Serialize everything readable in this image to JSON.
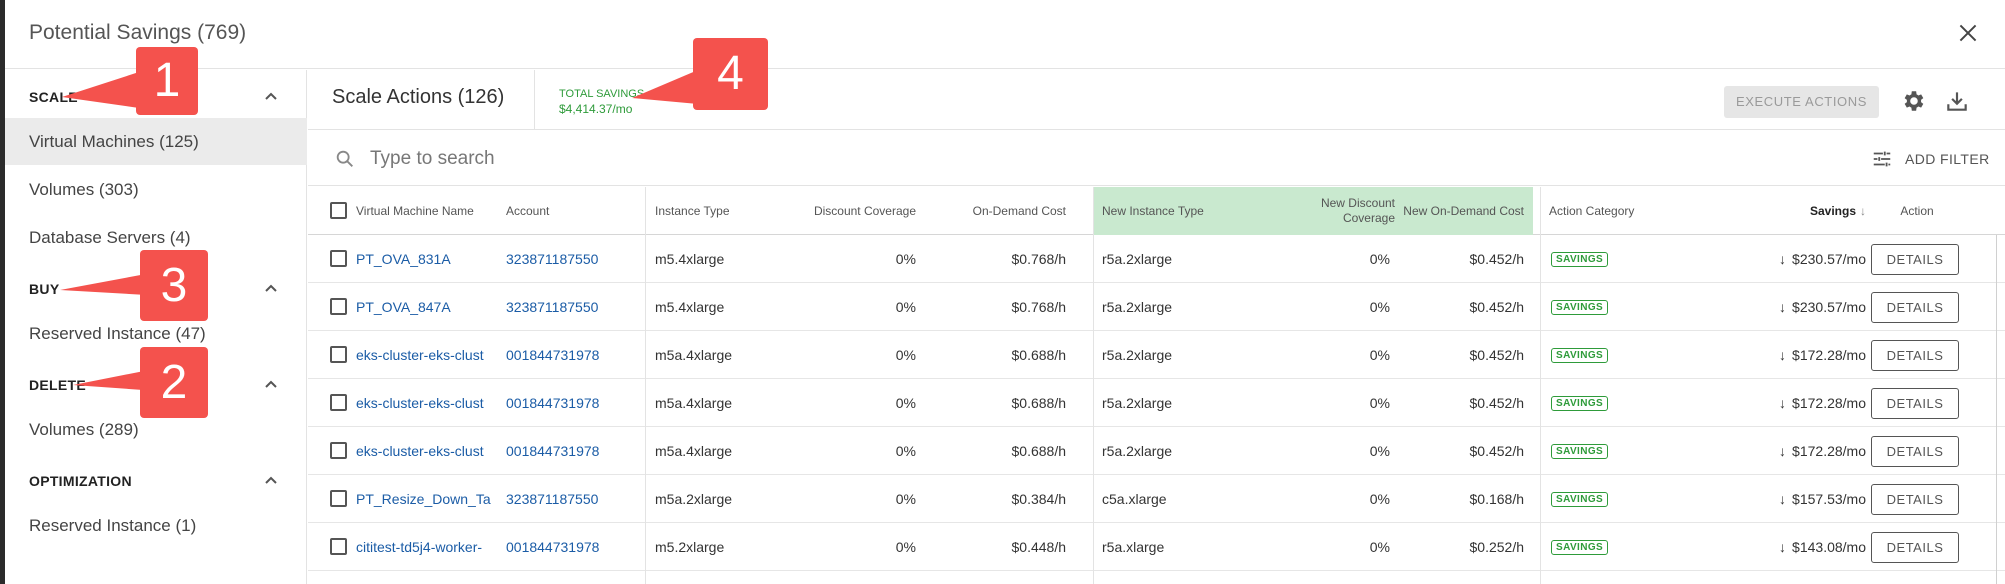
{
  "modal": {
    "title": "Potential Savings (769)"
  },
  "sidebar": {
    "sections": [
      {
        "label": "SCALE",
        "items": [
          "Virtual Machines (125)",
          "Volumes (303)",
          "Database Servers (4)"
        ]
      },
      {
        "label": "BUY",
        "items": [
          "Reserved Instance (47)"
        ]
      },
      {
        "label": "DELETE",
        "items": [
          "Volumes (289)"
        ]
      },
      {
        "label": "OPTIMIZATION",
        "items": [
          "Reserved Instance (1)"
        ]
      }
    ],
    "active_item": "Virtual Machines (125)"
  },
  "header": {
    "title": "Scale Actions (126)",
    "total_savings_label": "TOTAL SAVINGS",
    "total_savings_value": "$4,414.37/mo",
    "execute_label": "EXECUTE ACTIONS"
  },
  "search": {
    "placeholder": "Type to search",
    "add_filter_label": "ADD FILTER"
  },
  "table": {
    "columns": [
      "Virtual Machine Name",
      "Account",
      "Instance Type",
      "Discount Coverage",
      "On-Demand Cost",
      "New Instance Type",
      "New Discount Coverage",
      "New On-Demand Cost",
      "Action Category",
      "Savings",
      "Action"
    ],
    "highlight_color": "#c9e9cf",
    "rows": [
      {
        "name": "PT_OVA_831A",
        "account": "323871187550",
        "instance": "m5.4xlarge",
        "discount": "0%",
        "ondemand": "$0.768/h",
        "new_instance": "r5a.2xlarge",
        "new_discount": "0%",
        "new_ondemand": "$0.452/h",
        "category": "SAVINGS",
        "savings": "$230.57/mo",
        "action": "DETAILS"
      },
      {
        "name": "PT_OVA_847A",
        "account": "323871187550",
        "instance": "m5.4xlarge",
        "discount": "0%",
        "ondemand": "$0.768/h",
        "new_instance": "r5a.2xlarge",
        "new_discount": "0%",
        "new_ondemand": "$0.452/h",
        "category": "SAVINGS",
        "savings": "$230.57/mo",
        "action": "DETAILS"
      },
      {
        "name": "eks-cluster-eks-clust",
        "account": "001844731978",
        "instance": "m5a.4xlarge",
        "discount": "0%",
        "ondemand": "$0.688/h",
        "new_instance": "r5a.2xlarge",
        "new_discount": "0%",
        "new_ondemand": "$0.452/h",
        "category": "SAVINGS",
        "savings": "$172.28/mo",
        "action": "DETAILS"
      },
      {
        "name": "eks-cluster-eks-clust",
        "account": "001844731978",
        "instance": "m5a.4xlarge",
        "discount": "0%",
        "ondemand": "$0.688/h",
        "new_instance": "r5a.2xlarge",
        "new_discount": "0%",
        "new_ondemand": "$0.452/h",
        "category": "SAVINGS",
        "savings": "$172.28/mo",
        "action": "DETAILS"
      },
      {
        "name": "eks-cluster-eks-clust",
        "account": "001844731978",
        "instance": "m5a.4xlarge",
        "discount": "0%",
        "ondemand": "$0.688/h",
        "new_instance": "r5a.2xlarge",
        "new_discount": "0%",
        "new_ondemand": "$0.452/h",
        "category": "SAVINGS",
        "savings": "$172.28/mo",
        "action": "DETAILS"
      },
      {
        "name": "PT_Resize_Down_Ta",
        "account": "323871187550",
        "instance": "m5a.2xlarge",
        "discount": "0%",
        "ondemand": "$0.384/h",
        "new_instance": "c5a.xlarge",
        "new_discount": "0%",
        "new_ondemand": "$0.168/h",
        "category": "SAVINGS",
        "savings": "$157.53/mo",
        "action": "DETAILS"
      },
      {
        "name": "cititest-td5j4-worker-",
        "account": "001844731978",
        "instance": "m5.2xlarge",
        "discount": "0%",
        "ondemand": "$0.448/h",
        "new_instance": "r5a.xlarge",
        "new_discount": "0%",
        "new_ondemand": "$0.252/h",
        "category": "SAVINGS",
        "savings": "$143.08/mo",
        "action": "DETAILS"
      }
    ]
  },
  "callouts": [
    "1",
    "2",
    "3",
    "4"
  ],
  "colors": {
    "accent_green": "#2e9b3a",
    "link_blue": "#1b5ca6",
    "callout_red": "#f4524d"
  }
}
